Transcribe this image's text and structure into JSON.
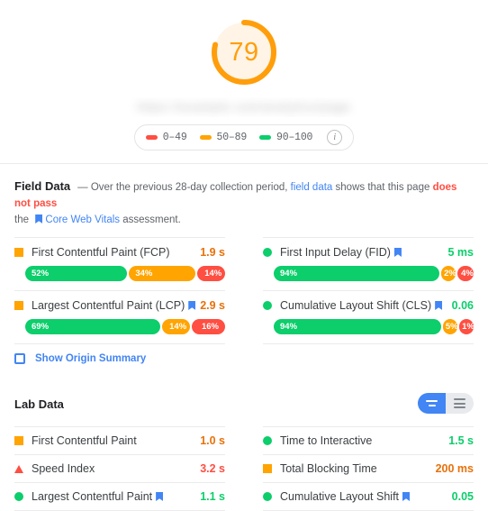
{
  "gauge": {
    "score": "79",
    "score_color": "#ff9e0b",
    "arc_percent": 79,
    "page_title_blurred": "https://example.com/analytics/page"
  },
  "legend": {
    "items": [
      {
        "range": "0–49",
        "color": "#ff4e42",
        "name": "legend-poor"
      },
      {
        "range": "50–89",
        "color": "#ffa400",
        "name": "legend-average"
      },
      {
        "range": "90–100",
        "color": "#0cce6b",
        "name": "legend-good"
      }
    ],
    "info_glyph": "i"
  },
  "field_data": {
    "title": "Field Data",
    "desc_part1": "—  Over the previous 28-day collection period, ",
    "desc_link1": "field data",
    "desc_part2": " shows that this page ",
    "desc_fail": "does not pass",
    "desc_part3": "the ",
    "desc_link2": "Core Web Vitals",
    "desc_part4": " assessment.",
    "metrics": [
      {
        "name": "First Contentful Paint (FCP)",
        "value": "1.9 s",
        "status": "average",
        "mark": "square-avg",
        "value_class": "v-orange-dark",
        "cwv": false,
        "distribution": [
          {
            "label": "52%",
            "pct": 52,
            "bucket": "good"
          },
          {
            "label": "34%",
            "pct": 34,
            "bucket": "average"
          },
          {
            "label": "14%",
            "pct": 14,
            "bucket": "poor"
          }
        ]
      },
      {
        "name": "First Input Delay (FID)",
        "value": "5 ms",
        "status": "good",
        "mark": "circle-pass",
        "value_class": "v-pass",
        "cwv": true,
        "distribution": [
          {
            "label": "94%",
            "pct": 94,
            "bucket": "good"
          },
          {
            "label": "2%",
            "pct": 2,
            "bucket": "average"
          },
          {
            "label": "4%",
            "pct": 4,
            "bucket": "poor"
          }
        ]
      },
      {
        "name": "Largest Contentful Paint (LCP)",
        "value": "2.9 s",
        "status": "average",
        "mark": "square-avg",
        "value_class": "v-orange-dark",
        "cwv": true,
        "distribution": [
          {
            "label": "69%",
            "pct": 69,
            "bucket": "good"
          },
          {
            "label": "14%",
            "pct": 14,
            "bucket": "average"
          },
          {
            "label": "16%",
            "pct": 16,
            "bucket": "poor"
          }
        ]
      },
      {
        "name": "Cumulative Layout Shift (CLS)",
        "value": "0.06",
        "status": "good",
        "mark": "circle-pass",
        "value_class": "v-pass",
        "cwv": true,
        "distribution": [
          {
            "label": "94%",
            "pct": 94,
            "bucket": "good"
          },
          {
            "label": "5%",
            "pct": 5,
            "bucket": "average"
          },
          {
            "label": "1%",
            "pct": 1,
            "bucket": "poor"
          }
        ]
      }
    ],
    "origin_summary_label": "Show Origin Summary",
    "origin_summary_checked": false
  },
  "lab_data": {
    "title": "Lab Data",
    "view_toggle": {
      "active": "list-view",
      "inactive": "detail-view"
    },
    "metrics": [
      {
        "name": "First Contentful Paint",
        "value": "1.0 s",
        "mark": "square-avg",
        "value_class": "v-orange-dark",
        "cwv": false
      },
      {
        "name": "Time to Interactive",
        "value": "1.5 s",
        "mark": "circle-pass",
        "value_class": "v-pass",
        "cwv": false
      },
      {
        "name": "Speed Index",
        "value": "3.2 s",
        "mark": "tri-fail",
        "value_class": "v-fail",
        "cwv": false
      },
      {
        "name": "Total Blocking Time",
        "value": "200 ms",
        "mark": "square-avg",
        "value_class": "v-orange-dark",
        "cwv": false
      },
      {
        "name": "Largest Contentful Paint",
        "value": "1.1 s",
        "mark": "circle-pass",
        "value_class": "v-pass",
        "cwv": true
      },
      {
        "name": "Cumulative Layout Shift",
        "value": "0.05",
        "mark": "circle-pass",
        "value_class": "v-pass",
        "cwv": true
      }
    ]
  }
}
